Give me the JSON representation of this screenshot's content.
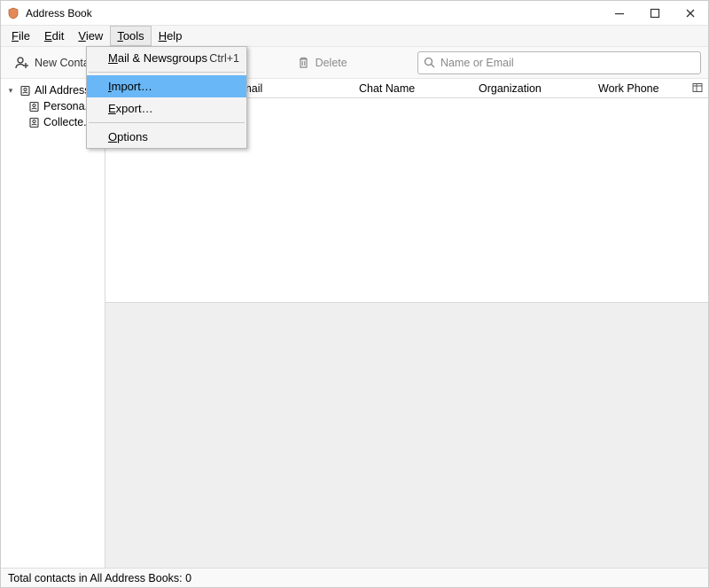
{
  "titlebar": {
    "title": "Address Book"
  },
  "menubar": {
    "file": "File",
    "edit": "Edit",
    "view": "View",
    "tools": "Tools",
    "help": "Help"
  },
  "toolbar": {
    "new_contact": "New Contact",
    "delete": "Delete",
    "search_placeholder": "Name or Email"
  },
  "dropdown": {
    "mail_newsgroups": "Mail & Newsgroups",
    "mail_shortcut": "Ctrl+1",
    "import": "Import…",
    "export": "Export…",
    "options": "Options"
  },
  "sidebar": {
    "all": "All Address",
    "personal": "Persona.",
    "collected": "Collecte."
  },
  "columns": {
    "email": "Email",
    "chat": "Chat Name",
    "org": "Organization",
    "workphone": "Work Phone"
  },
  "statusbar": {
    "text": "Total contacts in All Address Books: 0"
  }
}
